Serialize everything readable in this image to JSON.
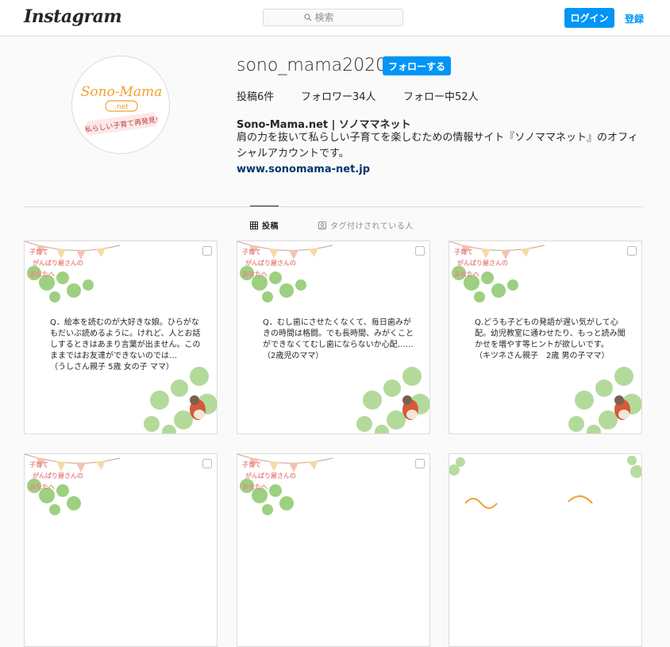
{
  "header": {
    "logo": "Instagram",
    "search_placeholder": "検索",
    "login_label": "ログイン",
    "signup_label": "登録"
  },
  "profile": {
    "username": "sono_mama2020",
    "follow_label": "フォローする",
    "stats": {
      "posts": "投稿6件",
      "followers": "フォロワー34人",
      "following": "フォロー中52人"
    },
    "bio_name": "Sono-Mama.net | ソノママネット",
    "bio_text": "肩の力を抜いて私らしい子育てを楽しむための情報サイト『ソノママネット』のオフィシャルアカウントです。",
    "website": "www.sonomama-net.jp",
    "avatar_logo": {
      "line1": "Sono-Mama",
      "line2": ".net",
      "line3": "私らしい子育て再発見!"
    }
  },
  "tabs": {
    "posts": "投稿",
    "tagged": "タグ付けされている人"
  },
  "post_banner": [
    "子育て",
    "がんばり屋さんの",
    "あなたへ"
  ],
  "posts": [
    {
      "text": "Q．絵本を読むのが大好きな娘。ひらがなもだいぶ読めるように。けれど、人とお話しするときはあまり言葉が出ません。このままではお友達ができないのでは…\n（うしさん親子 5歳 女の子 ママ）"
    },
    {
      "text": "Q．むし歯にさせたくなくて、毎日歯みがきの時間は格闘。でも長時間、みがくことができなくてむし歯にならないか心配……（2歳児のママ）"
    },
    {
      "text": "Q.どうも子どもの発語が遅い気がして心配。幼児教室に通わせたり、もっと読み聞かせを増やす等ヒントが欲しいです。\n（キツネさん親子　2歳 男の子ママ）"
    }
  ],
  "colors": {
    "accent": "#0095f6",
    "banner_pink": "#e98a8a",
    "leaf_green": "#7fbf5f",
    "brand_orange": "#f0a030"
  }
}
